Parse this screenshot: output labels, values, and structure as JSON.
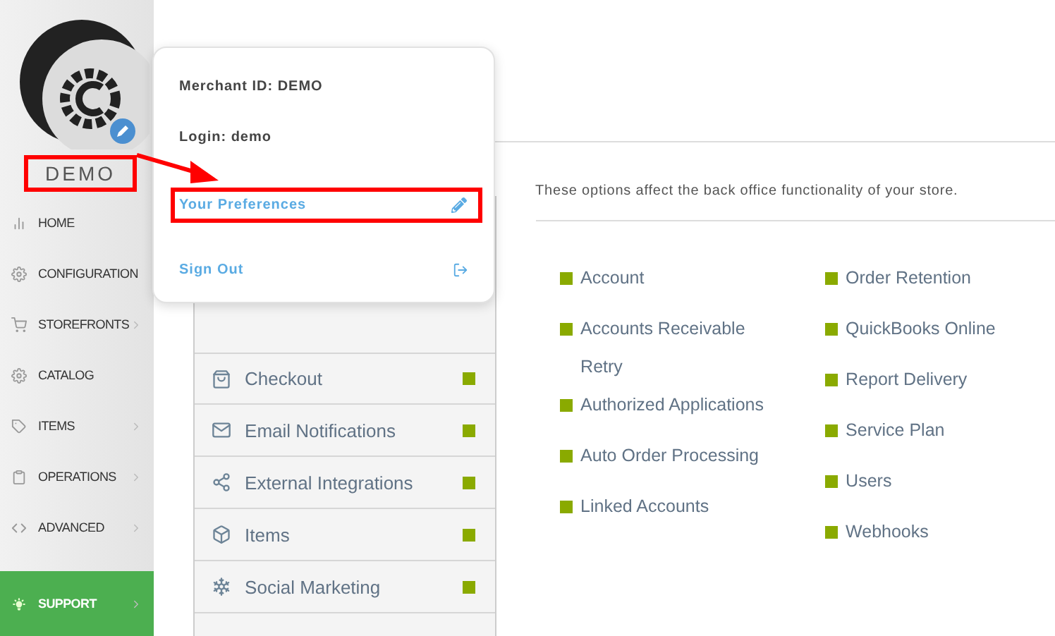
{
  "account": {
    "name": "DEMO"
  },
  "sidebar": {
    "items": [
      {
        "label": "HOME",
        "has_submenu": false,
        "selected": false
      },
      {
        "label": "CONFIGURATION",
        "has_submenu": false,
        "selected": false
      },
      {
        "label": "STOREFRONTS",
        "has_submenu": true,
        "selected": false
      },
      {
        "label": "CATALOG",
        "has_submenu": false,
        "selected": false
      },
      {
        "label": "ITEMS",
        "has_submenu": true,
        "selected": false
      },
      {
        "label": "OPERATIONS",
        "has_submenu": true,
        "selected": false
      },
      {
        "label": "ADVANCED",
        "has_submenu": true,
        "selected": false
      }
    ],
    "support": {
      "label": "SUPPORT",
      "selected": true
    }
  },
  "popup": {
    "merchant": "Merchant ID: DEMO",
    "login": "Login: demo",
    "preferences": "Your Preferences",
    "sign_out": "Sign Out"
  },
  "categories": [
    {
      "label": "Checkout"
    },
    {
      "label": "Email Notifications"
    },
    {
      "label": "External Integrations"
    },
    {
      "label": "Items"
    },
    {
      "label": "Social Marketing"
    }
  ],
  "description": "These options affect the back office functionality of your store.",
  "links": [
    [
      "Account",
      "Accounts Receivable Retry",
      "Authorized Applications",
      "Auto Order Processing",
      "Linked Accounts"
    ],
    [
      "Order Retention",
      "QuickBooks Online",
      "Report Delivery",
      "Service Plan",
      "Users",
      "Webhooks"
    ]
  ]
}
